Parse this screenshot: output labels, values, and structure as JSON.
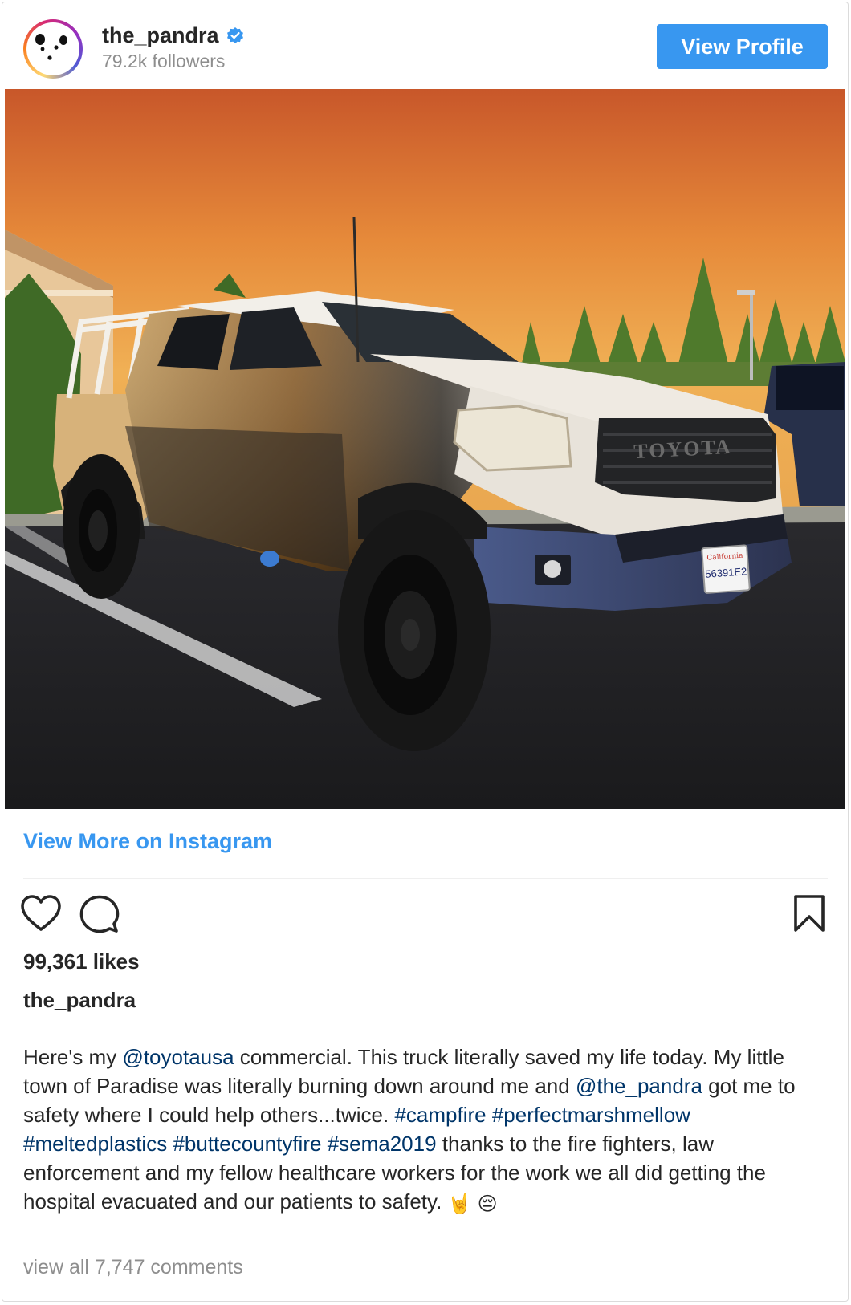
{
  "post": {
    "username": "the_pandra",
    "followers": "79.2k followers",
    "view_profile_label": "View Profile",
    "view_more_label": "View More on Instagram",
    "likes": "99,361 likes",
    "caption_username": "the_pandra",
    "caption": {
      "t1": "Here's my ",
      "m1": "@toyotausa",
      "t2": " commercial. This truck literally saved my life today. My little town of Paradise was literally burning down around me and ",
      "m2": "@the_pandra",
      "t3": " got me to safety where I could help others...twice. ",
      "h1": "#campfire",
      "h2": "#perfectmarshmellow",
      "h3": "#meltedplastics",
      "h4": "#buttecountyfire",
      "h5": "#sema2019",
      "t4": " thanks to the fire fighters, law enforcement and my fellow healthcare workers for the work we all did getting the hospital evacuated and our patients to safety. ",
      "e1": "🤘",
      "e2": "😔"
    },
    "view_comments": "view all 7,747 comments"
  },
  "photo": {
    "grille_text": "TOYOTA",
    "plate_text": "56391E2",
    "plate_state": "California"
  },
  "icons": {
    "avatar": "panda-avatar-icon",
    "verified": "verified-badge-icon",
    "like": "heart-icon",
    "comment": "comment-bubble-icon",
    "save": "bookmark-icon"
  },
  "colors": {
    "accent": "#3897f0",
    "link": "#003569",
    "muted": "#8e8e8e"
  }
}
